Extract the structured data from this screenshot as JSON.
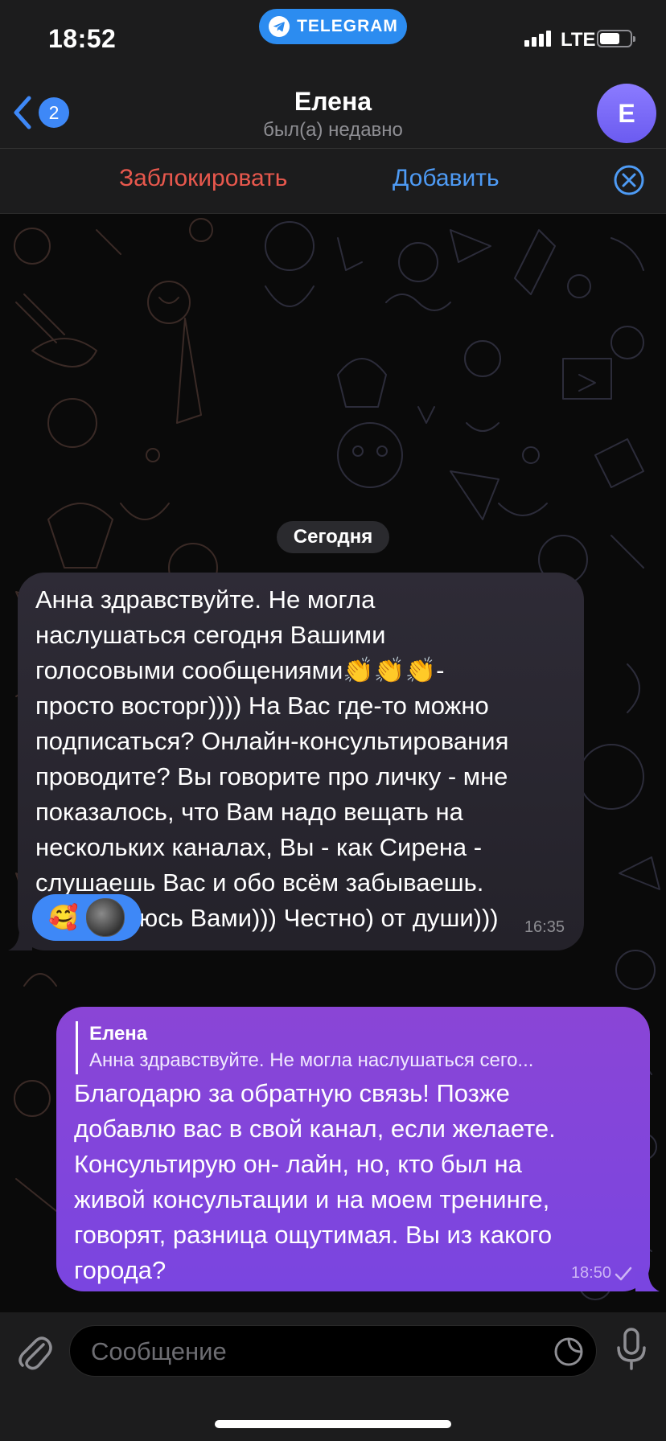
{
  "status_bar": {
    "time": "18:52",
    "app_pill": "TELEGRAM",
    "network": "LTE"
  },
  "header": {
    "back_count": "2",
    "name": "Елена",
    "status": "был(а) недавно",
    "avatar_letter": "E"
  },
  "actions": {
    "block": "Заблокировать",
    "add": "Добавить"
  },
  "chat": {
    "date_label": "Сегодня",
    "messages": [
      {
        "direction": "incoming",
        "text": "Анна здравствуйте. Не могла\nнаслушаться сегодня Вашими\nголосовыми сообщениями👏👏👏-\nпросто восторг)))) На Вас где-то можно\nподписаться? Онлайн-консультирования\nпроводите? Вы говорите про личку - мне\nпоказалось, что Вам надо вещать на\nнескольких каналах, Вы - как Сирена -\nслушаешь Вас и обо всём забываешь.\nВосхищаюсь Вами))) Честно) от души)))",
        "reaction_emoji": "🥰",
        "time": "16:35"
      },
      {
        "direction": "outgoing",
        "reply_name": "Елена",
        "reply_text": "Анна здравствуйте. Не могла наслушаться сего...",
        "text": "Благодарю за обратную связь! Позже\nдобавлю вас в свой канал, если желаете.\nКонсультирую он- лайн, но, кто был на\nживой консультации и на моем тренинге,\nговорят, разница ощутимая. Вы из какого\nгорода?",
        "time": "18:50",
        "status_icon": "check-icon"
      }
    ]
  },
  "composer": {
    "placeholder": "Сообщение"
  },
  "colors": {
    "accent_blue": "#3e88f7",
    "block_red": "#e8584d",
    "outgoing_bubble": "#8a45d6"
  }
}
